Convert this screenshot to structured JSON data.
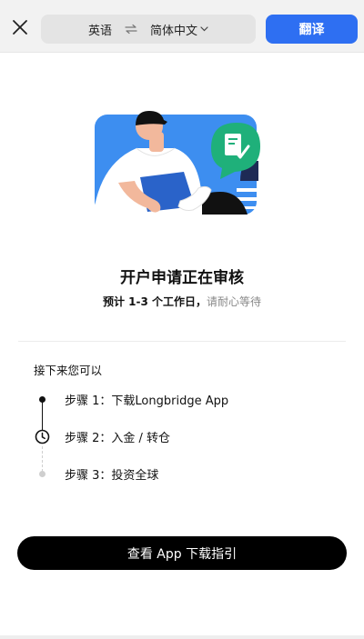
{
  "topbar": {
    "source_language": "英语",
    "target_language": "简体中文",
    "translate_label": "翻译"
  },
  "page": {
    "title": "开户申请正在审核",
    "subtitle_strong": "预计 1-3 个工作日，",
    "subtitle_muted": "请耐心等待",
    "next_heading": "接下来您可以",
    "steps": [
      {
        "label": "步骤 1：下载Longbridge App",
        "state": "done"
      },
      {
        "label": "步骤 2：入金 / 转仓",
        "state": "current"
      },
      {
        "label": "步骤 3：投资全球",
        "state": "pending"
      }
    ],
    "cta_label": "查看 App 下载指引"
  },
  "colors": {
    "accent_blue": "#2e6ff2",
    "illustration_blue": "#3d8ef0",
    "badge_green": "#1fb07a",
    "cta_black": "#000000"
  }
}
